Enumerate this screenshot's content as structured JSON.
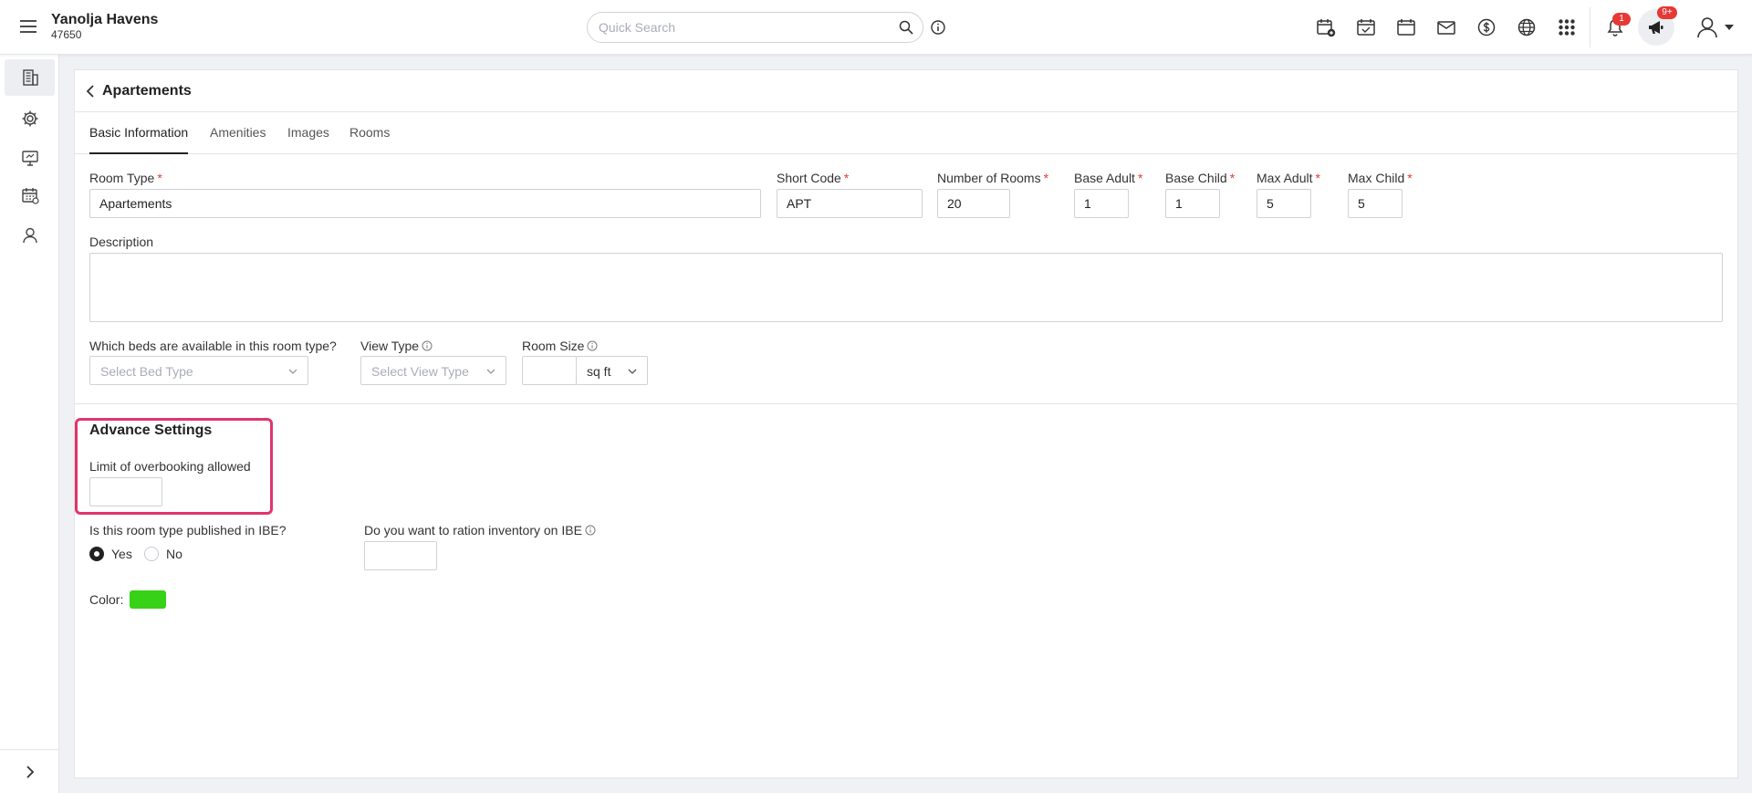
{
  "header": {
    "brand_name": "Yanolja Havens",
    "brand_id": "47650",
    "search_placeholder": "Quick Search",
    "notifications_count": "1",
    "announcements_count": "9+"
  },
  "page": {
    "title": "Apartements",
    "tabs": [
      {
        "label": "Basic Information",
        "active": true
      },
      {
        "label": "Amenities",
        "active": false
      },
      {
        "label": "Images",
        "active": false
      },
      {
        "label": "Rooms",
        "active": false
      }
    ]
  },
  "form": {
    "room_type": {
      "label": "Room Type",
      "value": "Apartements"
    },
    "short_code": {
      "label": "Short Code",
      "value": "APT"
    },
    "number_of_rooms": {
      "label": "Number of Rooms",
      "value": "20"
    },
    "base_adult": {
      "label": "Base Adult",
      "value": "1"
    },
    "base_child": {
      "label": "Base Child",
      "value": "1"
    },
    "max_adult": {
      "label": "Max Adult",
      "value": "5"
    },
    "max_child": {
      "label": "Max Child",
      "value": "5"
    },
    "description": {
      "label": "Description",
      "value": ""
    },
    "beds": {
      "label": "Which beds are available in this room type?",
      "placeholder": "Select Bed Type"
    },
    "view_type": {
      "label": "View Type",
      "placeholder": "Select View Type"
    },
    "room_size": {
      "label": "Room Size",
      "value": "",
      "unit": "sq ft"
    }
  },
  "advanced": {
    "title": "Advance Settings",
    "overbooking_label": "Limit of overbooking allowed",
    "overbooking_value": "",
    "ibe_published_label": "Is this room type published in IBE?",
    "ibe_options": [
      {
        "label": "Yes",
        "selected": true
      },
      {
        "label": "No",
        "selected": false
      }
    ],
    "ration_label": "Do you want to ration inventory on IBE",
    "ration_value": "",
    "color_label": "Color:",
    "color_value": "#37d117"
  },
  "colors": {
    "highlight": "#e0356b",
    "required": "#e53935",
    "badge": "#e53935"
  },
  "icons": {
    "sidebar": [
      "building-icon",
      "gear-icon",
      "monitor-icon",
      "calendar-icon",
      "user-icon"
    ],
    "header": [
      "calendar-add-icon",
      "calendar-check-icon",
      "calendar-icon",
      "mail-icon",
      "dollar-icon",
      "globe-icon",
      "apps-grid-icon",
      "bell-icon",
      "megaphone-icon",
      "user-icon"
    ]
  }
}
